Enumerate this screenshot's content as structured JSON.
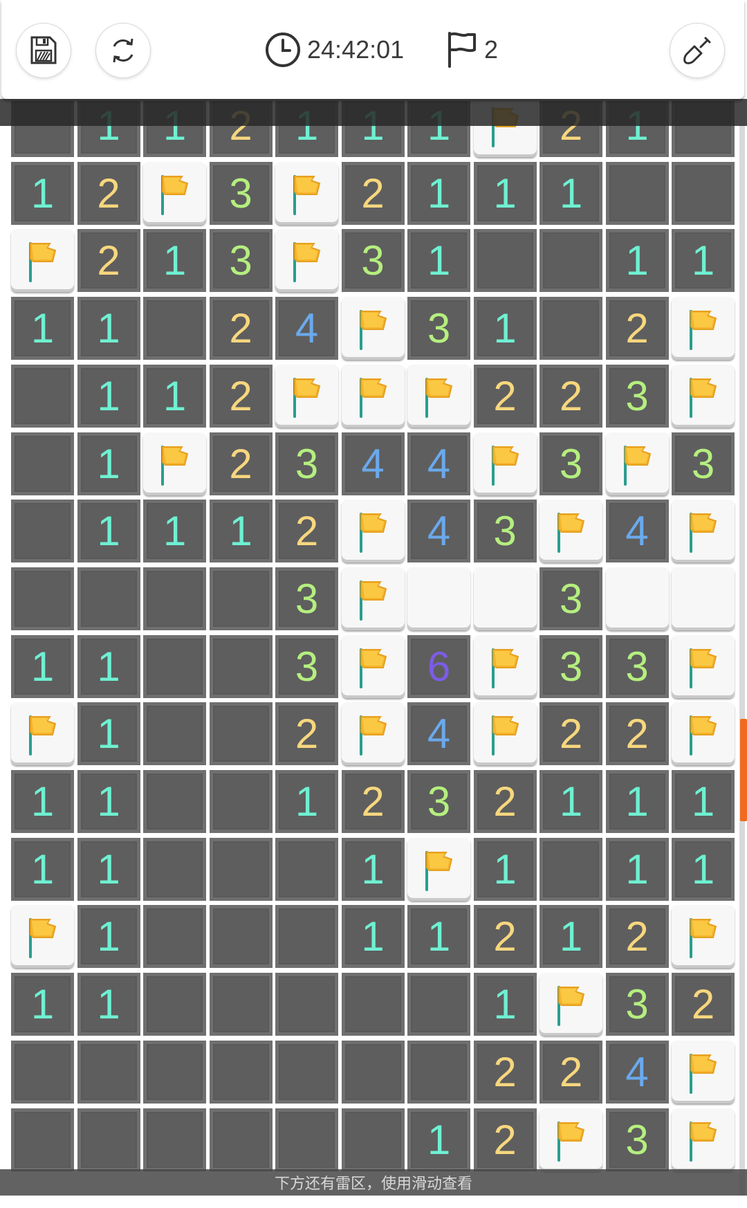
{
  "toolbar": {
    "save_icon": "save-icon",
    "restart_icon": "restart-icon",
    "timer_icon": "clock-icon",
    "timer_value": "24:42:01",
    "flag_icon": "flag-icon",
    "flags_remaining": "2",
    "dig_icon": "shovel-icon"
  },
  "board": {
    "rows": [
      [
        ".",
        "1",
        "1",
        "2",
        "1",
        "1",
        "1",
        "F",
        "2",
        "1",
        "."
      ],
      [
        "1",
        "2",
        "F",
        "3",
        "F",
        "2",
        "1",
        "1",
        "1",
        ".",
        "."
      ],
      [
        "F",
        "2",
        "1",
        "3",
        "F",
        "3",
        "1",
        ".",
        ".",
        "1",
        "1"
      ],
      [
        "1",
        "1",
        ".",
        "2",
        "4",
        "F",
        "3",
        "1",
        ".",
        "2",
        "F"
      ],
      [
        ".",
        "1",
        "1",
        "2",
        "F",
        "F",
        "F",
        "2",
        "2",
        "3",
        "F"
      ],
      [
        ".",
        "1",
        "F",
        "2",
        "3",
        "4",
        "4",
        "F",
        "3",
        "F",
        "3"
      ],
      [
        ".",
        "1",
        "1",
        "1",
        "2",
        "F",
        "4",
        "3",
        "F",
        "4",
        "F"
      ],
      [
        ".",
        ".",
        ".",
        ".",
        "3",
        "F",
        "#",
        "#",
        "3",
        "#",
        "#"
      ],
      [
        "1",
        "1",
        ".",
        ".",
        "3",
        "F",
        "6",
        "F",
        "3",
        "3",
        "F"
      ],
      [
        "F",
        "1",
        ".",
        ".",
        "2",
        "F",
        "4",
        "F",
        "2",
        "2",
        "F"
      ],
      [
        "1",
        "1",
        ".",
        ".",
        "1",
        "2",
        "3",
        "2",
        "1",
        "1",
        "1"
      ],
      [
        "1",
        "1",
        ".",
        ".",
        ".",
        "1",
        "F",
        "1",
        ".",
        "1",
        "1"
      ],
      [
        "F",
        "1",
        ".",
        ".",
        ".",
        "1",
        "1",
        "2",
        "1",
        "2",
        "F"
      ],
      [
        "1",
        "1",
        ".",
        ".",
        ".",
        ".",
        ".",
        "1",
        "F",
        "3",
        "2"
      ],
      [
        ".",
        ".",
        ".",
        ".",
        ".",
        ".",
        ".",
        "2",
        "2",
        "4",
        "F"
      ],
      [
        ".",
        ".",
        ".",
        ".",
        ".",
        ".",
        "1",
        "2",
        "F",
        "3",
        "F"
      ]
    ],
    "number_colors": {
      "1": "#6ff0d2",
      "2": "#f7d77e",
      "3": "#b5ef7f",
      "4": "#6aa9ec",
      "6": "#7c5ce6"
    }
  },
  "footer": {
    "hint": "下方还有雷区，使用滑动查看"
  }
}
